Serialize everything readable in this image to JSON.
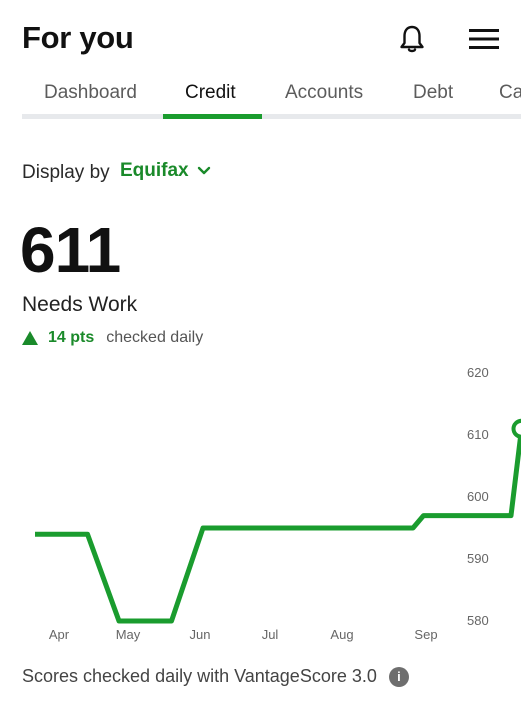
{
  "header": {
    "title": "For you"
  },
  "tabs": [
    {
      "label": "Dashboard"
    },
    {
      "label": "Credit"
    },
    {
      "label": "Accounts"
    },
    {
      "label": "Debt"
    },
    {
      "label": "Ca"
    }
  ],
  "active_tab": "Credit",
  "display": {
    "label": "Display by",
    "provider": "Equifax"
  },
  "score": {
    "value": "611",
    "status": "Needs Work",
    "delta": "14 pts",
    "frequency": "checked daily"
  },
  "footer": {
    "text": "Scores checked daily with VantageScore 3.0",
    "info_icon": "info-icon"
  },
  "colors": {
    "accent": "#1a9c2e",
    "accent_text": "#1a8a2a",
    "track": "#e7e9ec"
  },
  "chart_data": {
    "type": "line",
    "x_ticks": [
      "Apr",
      "May",
      "Jun",
      "Jul",
      "Aug",
      "Sep"
    ],
    "y_ticks": [
      "580",
      "590",
      "600",
      "610",
      "620"
    ],
    "ylim": [
      580,
      620
    ],
    "series": [
      {
        "points": [
          [
            0.0,
            594
          ],
          [
            0.75,
            594
          ],
          [
            1.2,
            580
          ],
          [
            1.95,
            580
          ],
          [
            2.4,
            595
          ],
          [
            5.4,
            595
          ],
          [
            5.55,
            597
          ],
          [
            6.8,
            597
          ],
          [
            6.95,
            611
          ]
        ]
      }
    ],
    "latest_point_marker": true
  }
}
